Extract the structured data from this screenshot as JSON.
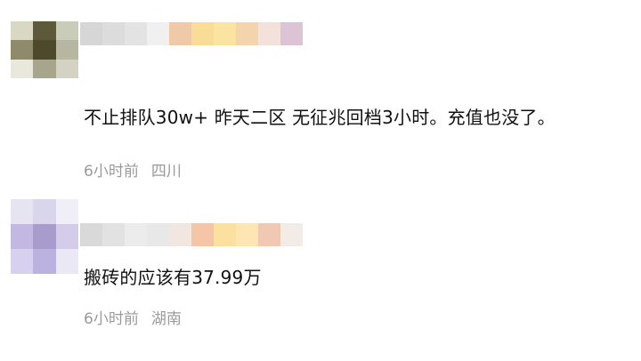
{
  "comments": [
    {
      "text": "不止排队30w+ 昨天二区 无征兆回档3小时。充值也没了。",
      "time": "6小时前",
      "location": "四川",
      "avatar_colors": [
        "#d8d8c4",
        "#5d5a3c",
        "#c9ccb8",
        "#8f8a6a",
        "#4d4a2c",
        "#b7b6a0",
        "#e9e8dc",
        "#a7a58c",
        "#d4d2c2"
      ],
      "name_colors": [
        "#d6d6d6",
        "#dcdcdc",
        "#e3e3e3",
        "#f0f0f0",
        "#f0c9a8",
        "#f9dd96",
        "#fbe4a2",
        "#f3d4ad",
        "#f2e2da",
        "#dcc4d6"
      ]
    },
    {
      "text": "搬砖的应该有37.99万",
      "time": "6小时前",
      "location": "湖南",
      "avatar_colors": [
        "#e7e4f1",
        "#d9d5ea",
        "#f0eef7",
        "#c2b8e2",
        "#a89ccd",
        "#d5cce9",
        "#d7d0ee",
        "#bcb2e0",
        "#ebe8f5"
      ],
      "name_colors": [
        "#d9d9d9",
        "#e2e2e2",
        "#ececec",
        "#e8e8e8",
        "#f1e7e0",
        "#f4c5a6",
        "#fbe0a0",
        "#fde6b2",
        "#f1c9b2",
        "#f3ece6"
      ]
    }
  ]
}
